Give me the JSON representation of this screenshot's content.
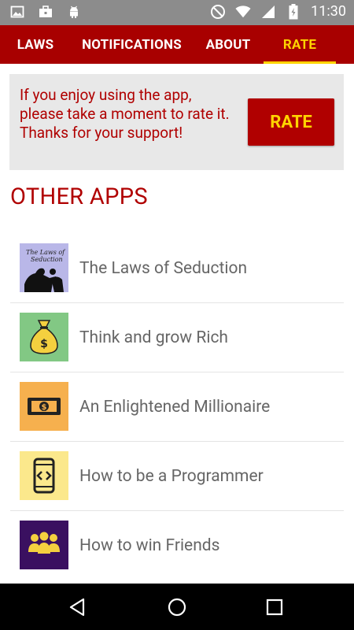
{
  "status_bar": {
    "time": "11:30",
    "left_icons": [
      "image-icon",
      "briefcase-icon",
      "android-icon"
    ],
    "right_icons": [
      "do-not-disturb-icon",
      "wifi-icon",
      "signal-icon",
      "battery-icon"
    ]
  },
  "tabs": [
    {
      "label": "LAWS",
      "active": false
    },
    {
      "label": "NOTIFICATIONS",
      "active": false
    },
    {
      "label": "ABOUT",
      "active": false
    },
    {
      "label": "RATE",
      "active": true
    }
  ],
  "rate_card": {
    "message_line1": "If you enjoy using the app, please take a moment to rate it.",
    "message_line2": "Thanks for your support!",
    "button_label": "RATE"
  },
  "other_apps": {
    "title": "OTHER APPS",
    "items": [
      {
        "name": "The Laws of Seduction",
        "icon": "laws-of-seduction-icon"
      },
      {
        "name": "Think and grow Rich",
        "icon": "money-bag-icon"
      },
      {
        "name": "An Enlightened Millionaire",
        "icon": "banknote-icon"
      },
      {
        "name": "How to be a Programmer",
        "icon": "code-phone-icon"
      },
      {
        "name": "How to win Friends",
        "icon": "people-group-icon"
      }
    ]
  },
  "colors": {
    "primary": "#a80000",
    "accent": "#ffd400",
    "card_bg": "#e8e8e8",
    "status_bar": "#8c8c8c"
  }
}
